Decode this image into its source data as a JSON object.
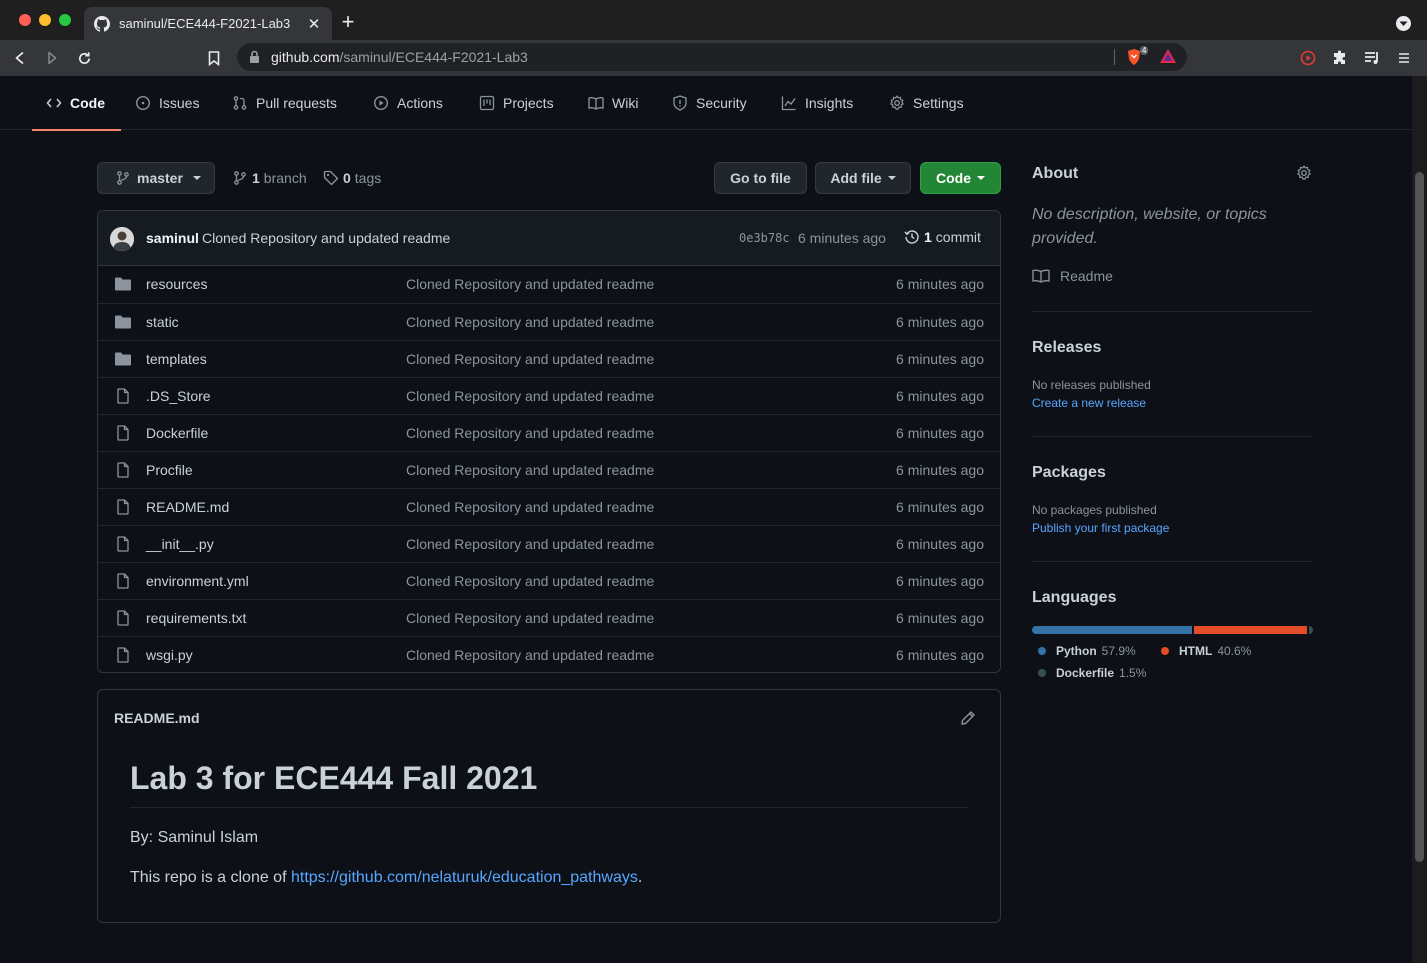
{
  "browser": {
    "tab_title": "saminul/ECE444-F2021-Lab3",
    "url_host": "github.com",
    "url_path": "/saminul/ECE444-F2021-Lab3",
    "shield_count": "4"
  },
  "repo_nav": {
    "items": [
      {
        "label": "Code",
        "icon": "code-icon"
      },
      {
        "label": "Issues",
        "icon": "issue-opened-icon"
      },
      {
        "label": "Pull requests",
        "icon": "git-pull-request-icon"
      },
      {
        "label": "Actions",
        "icon": "play-icon"
      },
      {
        "label": "Projects",
        "icon": "project-icon"
      },
      {
        "label": "Wiki",
        "icon": "book-icon"
      },
      {
        "label": "Security",
        "icon": "shield-icon"
      },
      {
        "label": "Insights",
        "icon": "graph-icon"
      },
      {
        "label": "Settings",
        "icon": "gear-icon"
      }
    ],
    "active": "Code"
  },
  "branch_bar": {
    "branch_name": "master",
    "branch_count": "1",
    "branch_label": "branch",
    "tag_count": "0",
    "tag_label": "tags",
    "go_to_file": "Go to file",
    "add_file": "Add file",
    "code": "Code"
  },
  "latest_commit": {
    "author": "saminul",
    "message": "Cloned Repository and updated readme",
    "sha": "0e3b78c",
    "time": "6 minutes ago",
    "count": "1",
    "count_label": "commit"
  },
  "files": [
    {
      "name": "resources",
      "type": "dir",
      "message": "Cloned Repository and updated readme",
      "age": "6 minutes ago"
    },
    {
      "name": "static",
      "type": "dir",
      "message": "Cloned Repository and updated readme",
      "age": "6 minutes ago"
    },
    {
      "name": "templates",
      "type": "dir",
      "message": "Cloned Repository and updated readme",
      "age": "6 minutes ago"
    },
    {
      "name": ".DS_Store",
      "type": "file",
      "message": "Cloned Repository and updated readme",
      "age": "6 minutes ago"
    },
    {
      "name": "Dockerfile",
      "type": "file",
      "message": "Cloned Repository and updated readme",
      "age": "6 minutes ago"
    },
    {
      "name": "Procfile",
      "type": "file",
      "message": "Cloned Repository and updated readme",
      "age": "6 minutes ago"
    },
    {
      "name": "README.md",
      "type": "file",
      "message": "Cloned Repository and updated readme",
      "age": "6 minutes ago"
    },
    {
      "name": "__init__.py",
      "type": "file",
      "message": "Cloned Repository and updated readme",
      "age": "6 minutes ago"
    },
    {
      "name": "environment.yml",
      "type": "file",
      "message": "Cloned Repository and updated readme",
      "age": "6 minutes ago"
    },
    {
      "name": "requirements.txt",
      "type": "file",
      "message": "Cloned Repository and updated readme",
      "age": "6 minutes ago"
    },
    {
      "name": "wsgi.py",
      "type": "file",
      "message": "Cloned Repository and updated readme",
      "age": "6 minutes ago"
    }
  ],
  "readme": {
    "filename": "README.md",
    "heading": "Lab 3 for ECE444 Fall 2021",
    "byline": "By: Saminul Islam",
    "clone_prefix": "This repo is a clone of ",
    "clone_link": "https://github.com/nelaturuk/education_pathways",
    "clone_suffix": "."
  },
  "sidebar": {
    "about_title": "About",
    "about_desc": "No description, website, or topics provided.",
    "readme_label": "Readme",
    "releases_title": "Releases",
    "releases_empty": "No releases published",
    "releases_link": "Create a new release",
    "packages_title": "Packages",
    "packages_empty": "No packages published",
    "packages_link": "Publish your first package",
    "languages_title": "Languages",
    "languages": [
      {
        "name": "Python",
        "percent": "57.9%",
        "value": 57.9,
        "color": "#3572A5"
      },
      {
        "name": "HTML",
        "percent": "40.6%",
        "value": 40.6,
        "color": "#e34c26"
      },
      {
        "name": "Dockerfile",
        "percent": "1.5%",
        "value": 1.5,
        "color": "#384d54"
      }
    ]
  },
  "colors": {
    "background": "#0d1117",
    "accent_green": "#238636",
    "link_blue": "#58a6ff",
    "active_tab_underline": "#f78166"
  }
}
